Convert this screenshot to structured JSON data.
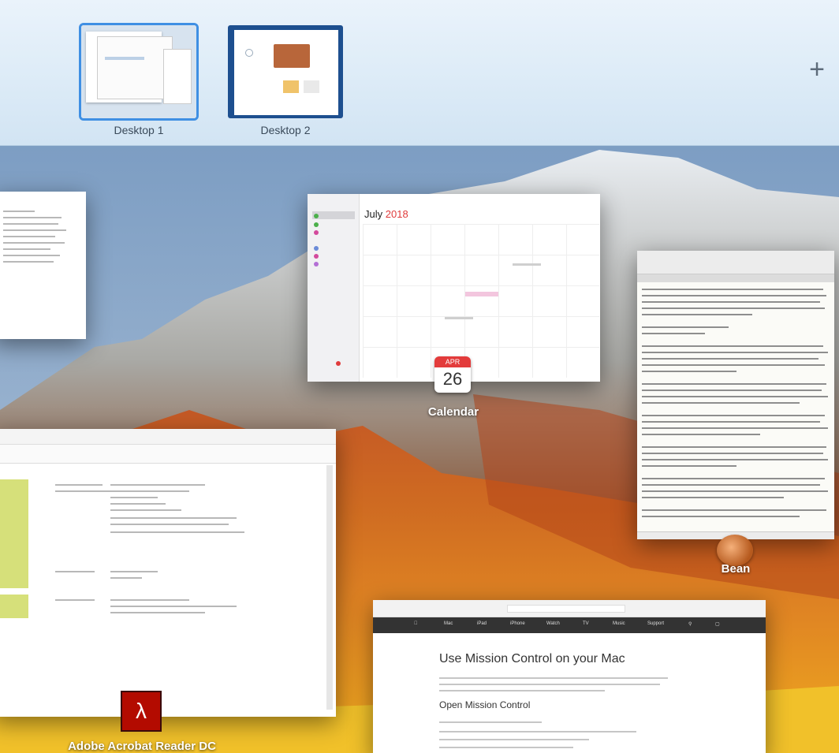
{
  "spaces": {
    "desktops": [
      {
        "label": "Desktop 1",
        "active": true
      },
      {
        "label": "Desktop 2",
        "active": false
      }
    ],
    "add_button": "+"
  },
  "windows": {
    "calendar": {
      "app_label": "Calendar",
      "month_title": "July",
      "year_title": "2018",
      "icon_month": "APR",
      "icon_day": "26"
    },
    "bean": {
      "app_label": "Bean"
    },
    "acrobat": {
      "app_label": "Adobe Acrobat Reader DC"
    },
    "browser": {
      "nav_items": [
        "Mac",
        "iPad",
        "iPhone",
        "Watch",
        "TV",
        "Music",
        "Support"
      ],
      "page_title": "Use Mission Control on your Mac",
      "section_title": "Open Mission Control"
    }
  },
  "colors": {
    "active_outline": "#3f8fe3",
    "calendar_accent": "#e03b3b",
    "acrobat_red": "#b30b00"
  }
}
